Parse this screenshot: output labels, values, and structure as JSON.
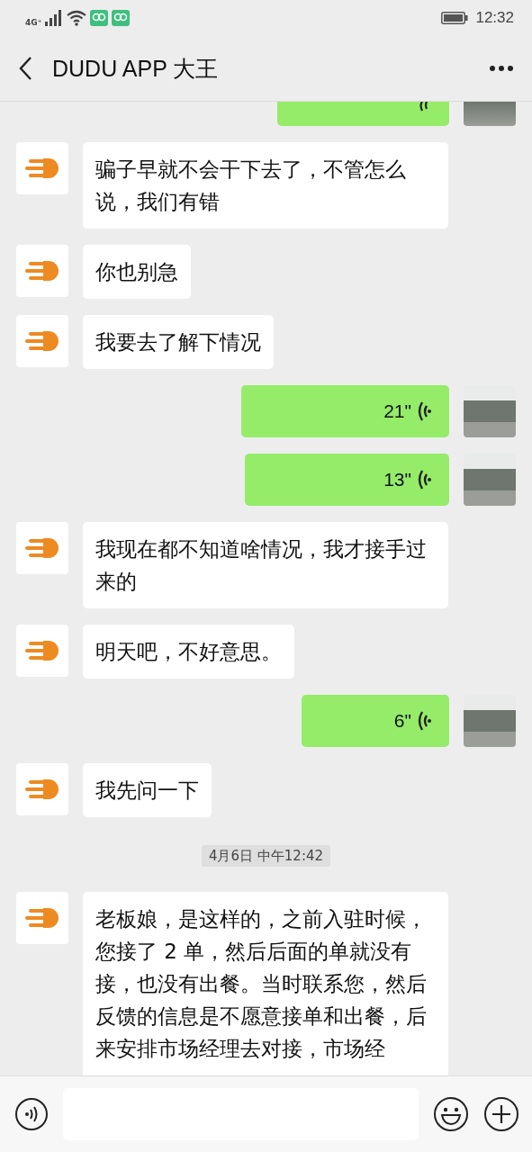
{
  "status_bar": {
    "network": "4G⁺",
    "time": "12:32"
  },
  "header": {
    "title": "DUDU APP 大王"
  },
  "messages": [
    {
      "kind": "voice-clipped"
    },
    {
      "kind": "text",
      "text": "骗子早就不会干下去了，不管怎么说，我们有错"
    },
    {
      "kind": "text",
      "text": "你也别急"
    },
    {
      "kind": "text",
      "text": "我要去了解下情况"
    },
    {
      "kind": "voice",
      "duration": "21\""
    },
    {
      "kind": "voice",
      "duration": "13\""
    },
    {
      "kind": "text",
      "text": "我现在都不知道啥情况，我才接手过来的"
    },
    {
      "kind": "text",
      "text": "明天吧，不好意思。"
    },
    {
      "kind": "voice",
      "duration": "6\""
    },
    {
      "kind": "text",
      "text": "我先问一下"
    },
    {
      "kind": "time",
      "text": "4月6日 中午12:42"
    },
    {
      "kind": "text-clipped",
      "text": "老板娘，是这样的，之前入驻时候，您接了 2 单，然后后面的单就没有接，也没有出餐。当时联系您，然后反馈的信息是不愿意接单和出餐，后来安排市场经理去对接，市场经"
    }
  ]
}
